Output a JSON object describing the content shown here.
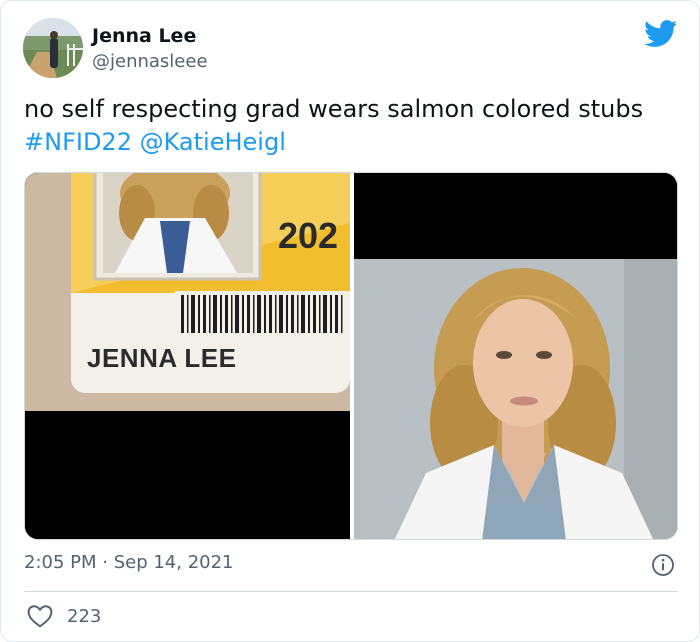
{
  "tweet": {
    "author": {
      "display_name": "Jenna Lee",
      "handle": "@jennasleee",
      "avatar_icon": "profile-photo"
    },
    "text": {
      "body": "no self respecting grad wears salmon colored stubs ",
      "hashtag": "#NFID22",
      "mention": "@KatieHeigl"
    },
    "media": {
      "id_card": {
        "name_on_card": "JENNA LEE",
        "year_fragment": "202"
      },
      "photo_icon": "portrait-photo"
    },
    "meta": {
      "time": "2:05 PM",
      "separator": " · ",
      "date": "Sep 14, 2021"
    },
    "stats": {
      "likes": "223"
    },
    "icons": {
      "brand": "twitter-bird-icon",
      "info": "info-icon",
      "like": "heart-icon"
    },
    "colors": {
      "link": "#1d9bf0",
      "secondary_text": "#536471",
      "primary_text": "#0f1419",
      "brand_blue": "#1d9bf0"
    }
  }
}
